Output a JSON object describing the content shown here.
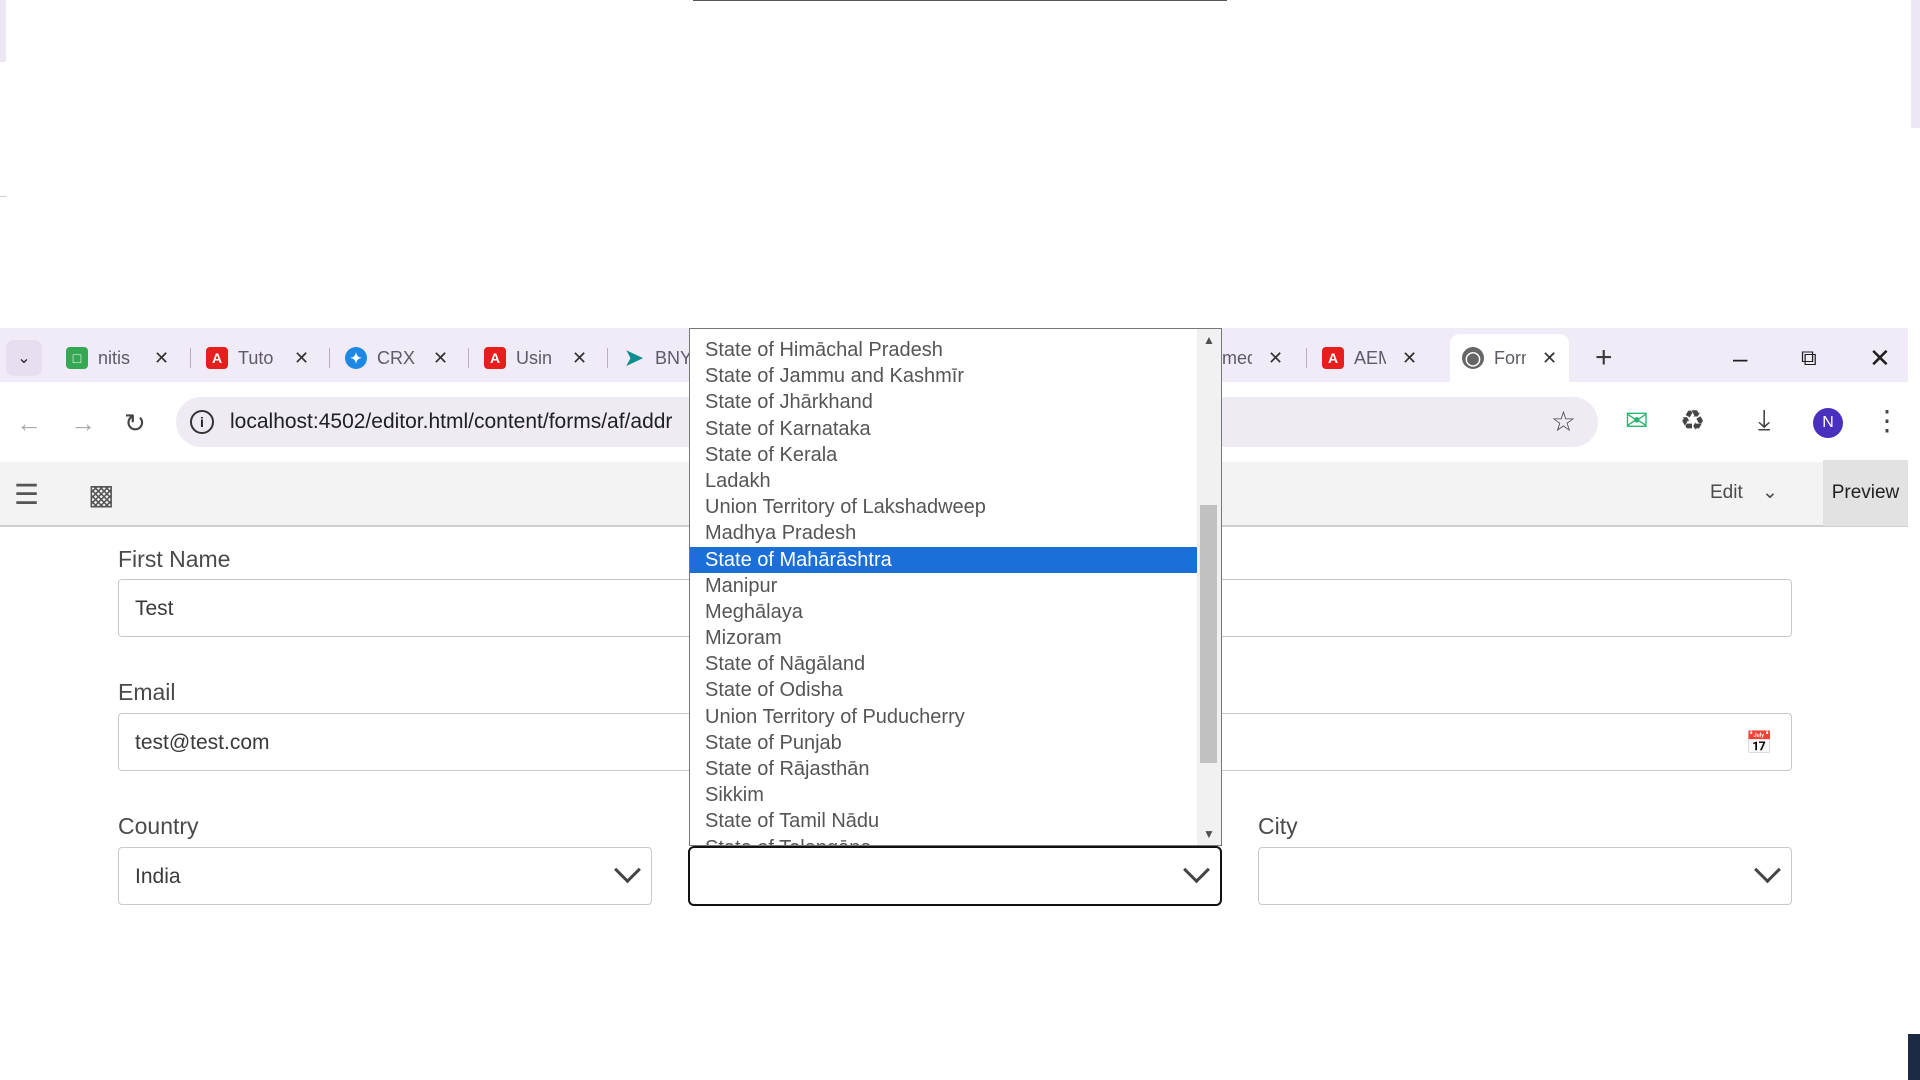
{
  "browser": {
    "tabs": [
      {
        "title": "nitis",
        "icon": "chat-icon",
        "color": "#34a853"
      },
      {
        "title": "Tuto",
        "icon": "adobe-icon",
        "color": "#e61e1e"
      },
      {
        "title": "CRX",
        "icon": "crx-icon",
        "color": "#1e88e5"
      },
      {
        "title": "Usin",
        "icon": "adobe-icon",
        "color": "#e61e1e"
      },
      {
        "title": "BNY",
        "icon": "send-icon",
        "color": "#0b8f8f"
      },
      {
        "title": "med",
        "icon": "page-icon",
        "color": "#888888"
      },
      {
        "title": "AEM",
        "icon": "adobe-icon",
        "color": "#e61e1e"
      },
      {
        "title": "Form",
        "icon": "globe-icon",
        "color": "#555555"
      }
    ],
    "url": "localhost:4502/editor.html/content/forms/af/addr",
    "avatar_letter": "N"
  },
  "editor": {
    "mode_label": "Edit",
    "preview_label": "Preview"
  },
  "form": {
    "first_name_label": "First Name",
    "first_name_value": "Test",
    "email_label": "Email",
    "email_value": "test@test.com",
    "country_label": "Country",
    "country_value": "India",
    "state_value": "",
    "city_label": "City",
    "city_value": ""
  },
  "state_dropdown": {
    "selected": "State of Mahārāshtra",
    "options": [
      "State of Himāchal Pradesh",
      "State of Jammu and Kashmīr",
      "State of Jhārkhand",
      "State of Karnataka",
      "State of Kerala",
      "Ladakh",
      "Union Territory of Lakshadweep",
      "Madhya Pradesh",
      "State of Mahārāshtra",
      "Manipur",
      "Meghālaya",
      "Mizoram",
      "State of Nāgāland",
      "State of Odisha",
      "Union Territory of Puducherry",
      "State of Punjab",
      "State of Rājasthān",
      "Sikkim",
      "State of Tamil Nādu",
      "State of Telangāna"
    ]
  }
}
